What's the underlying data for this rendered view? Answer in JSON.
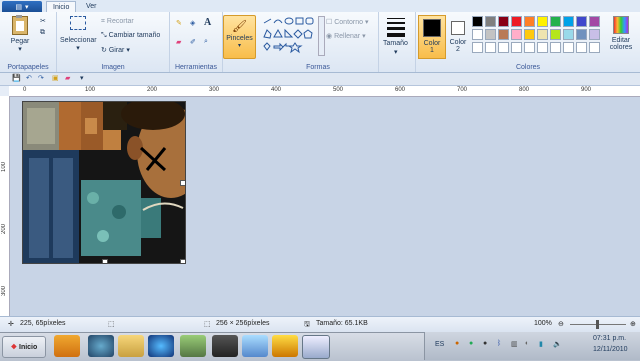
{
  "tabs": {
    "home": "Inicio",
    "view": "Ver"
  },
  "clipboard": {
    "paste": "Pegar",
    "label": "Portapapeles"
  },
  "image": {
    "select": "Seleccionar",
    "crop": "Recortar",
    "resize": "Cambiar tamaño",
    "rotate": "Girar",
    "label": "Imagen"
  },
  "tools": {
    "label": "Herramientas",
    "brushes": "Pinceles"
  },
  "shapes": {
    "outline": "Contorno",
    "fill": "Rellenar",
    "label": "Formas"
  },
  "size": {
    "label": "Tamaño"
  },
  "colors": {
    "color1_label": "Color",
    "color1_num": "1",
    "color2_label": "Color",
    "color2_num": "2",
    "edit_label1": "Editar",
    "edit_label2": "colores",
    "label": "Colores",
    "palette_row1": [
      "#000000",
      "#7f7f7f",
      "#880015",
      "#ed1c24",
      "#ff7f27",
      "#fff200",
      "#22b14c",
      "#00a2e8",
      "#3f48cc",
      "#a349a4"
    ],
    "palette_row2": [
      "#ffffff",
      "#c3c3c3",
      "#b97a57",
      "#ffaec9",
      "#ffc90e",
      "#efe4b0",
      "#b5e61d",
      "#99d9ea",
      "#7092be",
      "#c8bfe7"
    ],
    "palette_row3": [
      "#ffffff",
      "#ffffff",
      "#ffffff",
      "#ffffff",
      "#ffffff",
      "#ffffff",
      "#ffffff",
      "#ffffff",
      "#ffffff",
      "#ffffff"
    ]
  },
  "ruler": {
    "h": [
      "0",
      "100",
      "200",
      "300",
      "400",
      "500",
      "600",
      "700",
      "800",
      "900"
    ],
    "v": [
      "100",
      "200",
      "300"
    ]
  },
  "status": {
    "cursor": "225, 65píxeles",
    "dimensions": "256 × 256píxeles",
    "filesize": "Tamaño: 65.1KB",
    "zoom": "100%"
  },
  "taskbar": {
    "start": "Inicio",
    "lang": "ES",
    "time": "07:31 p.m.",
    "date": "12/11/2010"
  }
}
